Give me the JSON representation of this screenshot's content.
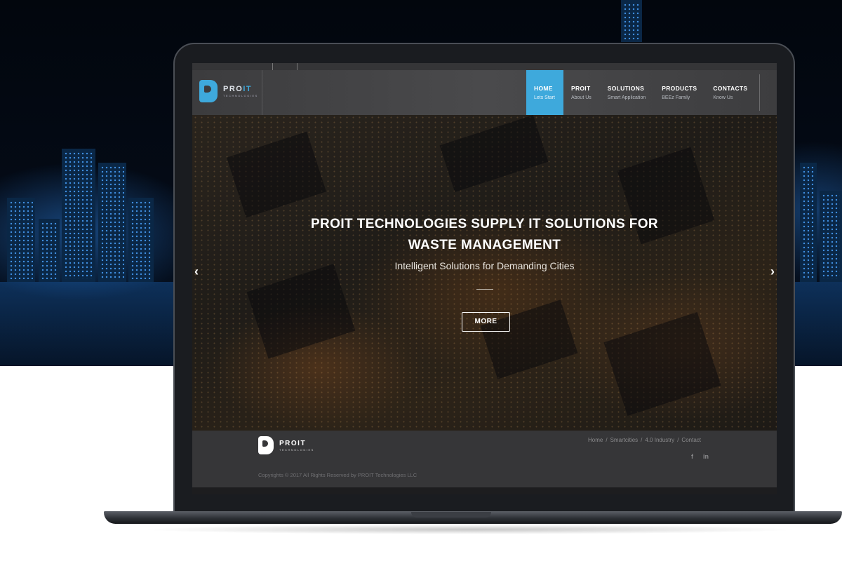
{
  "site": {
    "logo_text_main": "PRO",
    "logo_text_accent": "IT",
    "logo_subtext": "TECHNOLOGIES"
  },
  "nav": {
    "items": [
      {
        "label": "HOME",
        "sub": "Lets Start",
        "active": true
      },
      {
        "label": "PROIT",
        "sub": "About Us",
        "active": false
      },
      {
        "label": "SOLUTIONS",
        "sub": "Smart Application",
        "active": false
      },
      {
        "label": "PRODUCTS",
        "sub": "BEEz Family",
        "active": false
      },
      {
        "label": "CONTACTS",
        "sub": "Know Us",
        "active": false
      }
    ]
  },
  "hero": {
    "title_line1": "PROIT TECHNOLOGIES SUPPLY IT SOLUTIONS FOR",
    "title_line2": "WASTE MANAGEMENT",
    "subtitle": "Intelligent Solutions for Demanding Cities",
    "button_label": "MORE",
    "prev_arrow": "‹",
    "next_arrow": "›"
  },
  "footer": {
    "logo_text": "PROIT",
    "logo_subtext": "TECHNOLOGIES",
    "breadcrumbs": [
      "Home",
      "Smartcities",
      "4.0 Industry",
      "Contact"
    ],
    "separator": "/",
    "social": {
      "facebook": "f",
      "linkedin": "in"
    },
    "copyright": "Copyrights © 2017 All Rights Reserved by PROIT Technologies LLC"
  },
  "colors": {
    "accent": "#3ea9dc",
    "header_bg": "#4a4a4c",
    "footer_bg": "#363638"
  },
  "icons": [
    "proit-logo-icon",
    "chevron-left-icon",
    "chevron-right-icon",
    "facebook-icon",
    "linkedin-icon"
  ]
}
